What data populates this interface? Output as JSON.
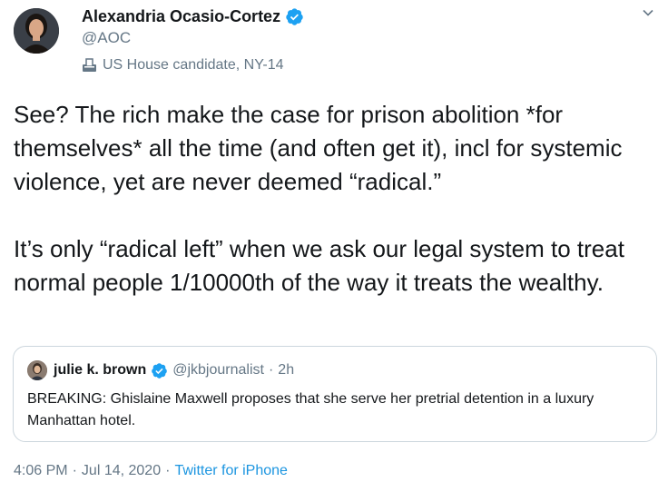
{
  "author": {
    "name": "Alexandria Ocasio-Cortez",
    "handle": "@AOC",
    "label": "US House candidate, NY-14",
    "label_icon": "ballot-box-icon",
    "verified_icon": "verified-badge-icon"
  },
  "tweet": {
    "text": "See? The rich make the case for prison abolition *for themselves* all the time (and often get it), incl for systemic violence, yet are never deemed “radical.”\n\nIt’s only “radical left” when we ask our legal system to treat normal people 1/10000th of the way it treats the wealthy."
  },
  "quoted": {
    "name": "julie k. brown",
    "handle": "@jkbjournalist",
    "separator": "·",
    "time": "2h",
    "text": "BREAKING: Ghislaine Maxwell proposes that she serve her pretrial detention in a luxury Manhattan hotel."
  },
  "meta": {
    "time": "4:06 PM",
    "sep1": "·",
    "date": "Jul 14, 2020",
    "sep2": "·",
    "source": "Twitter for iPhone"
  },
  "colors": {
    "link": "#1b95e0",
    "muted": "#657786",
    "text": "#14171a",
    "border": "#ccd6dd",
    "verified": "#1da1f2"
  }
}
